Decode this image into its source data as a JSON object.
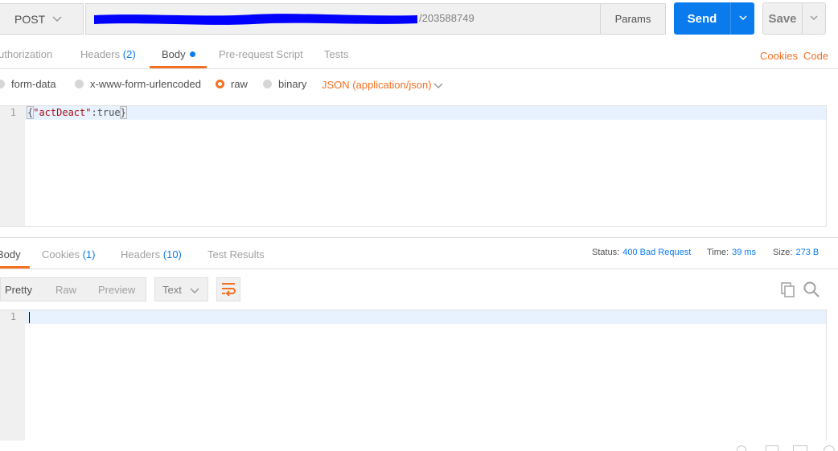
{
  "request": {
    "method": "POST",
    "url_visible_suffix": "/203588749",
    "params_label": "Params",
    "send_label": "Send",
    "save_label": "Save"
  },
  "request_tabs": {
    "authorization": "uthorization",
    "headers_label": "Headers",
    "headers_count": "(2)",
    "body_label": "Body",
    "prerequest": "Pre-request Script",
    "tests": "Tests",
    "cookies_link": "Cookies",
    "code_link": "Code"
  },
  "body_types": {
    "form_data": "form-data",
    "urlencoded": "x-www-form-urlencoded",
    "raw": "raw",
    "binary": "binary",
    "selected": "raw",
    "content_type": "JSON (application/json)"
  },
  "request_editor": {
    "line_number": "1",
    "code_open": "{",
    "code_key": "\"actDeact\"",
    "code_rest": ":true",
    "code_close": "}"
  },
  "response_tabs": {
    "body_label": "Body",
    "cookies_label": "Cookies",
    "cookies_count": "(1)",
    "headers_label": "Headers",
    "headers_count": "(10)",
    "test_results": "Test Results"
  },
  "response_meta": {
    "status_label": "Status:",
    "status_value": "400 Bad Request",
    "time_label": "Time:",
    "time_value": "39 ms",
    "size_label": "Size:",
    "size_value": "273 B"
  },
  "response_toolbar": {
    "pretty": "Pretty",
    "raw": "Raw",
    "preview": "Preview",
    "format": "Text"
  },
  "response_editor": {
    "line_number": "1"
  },
  "colors": {
    "accent_orange": "#f47023",
    "accent_blue": "#097bed",
    "redaction": "#0000ff"
  }
}
